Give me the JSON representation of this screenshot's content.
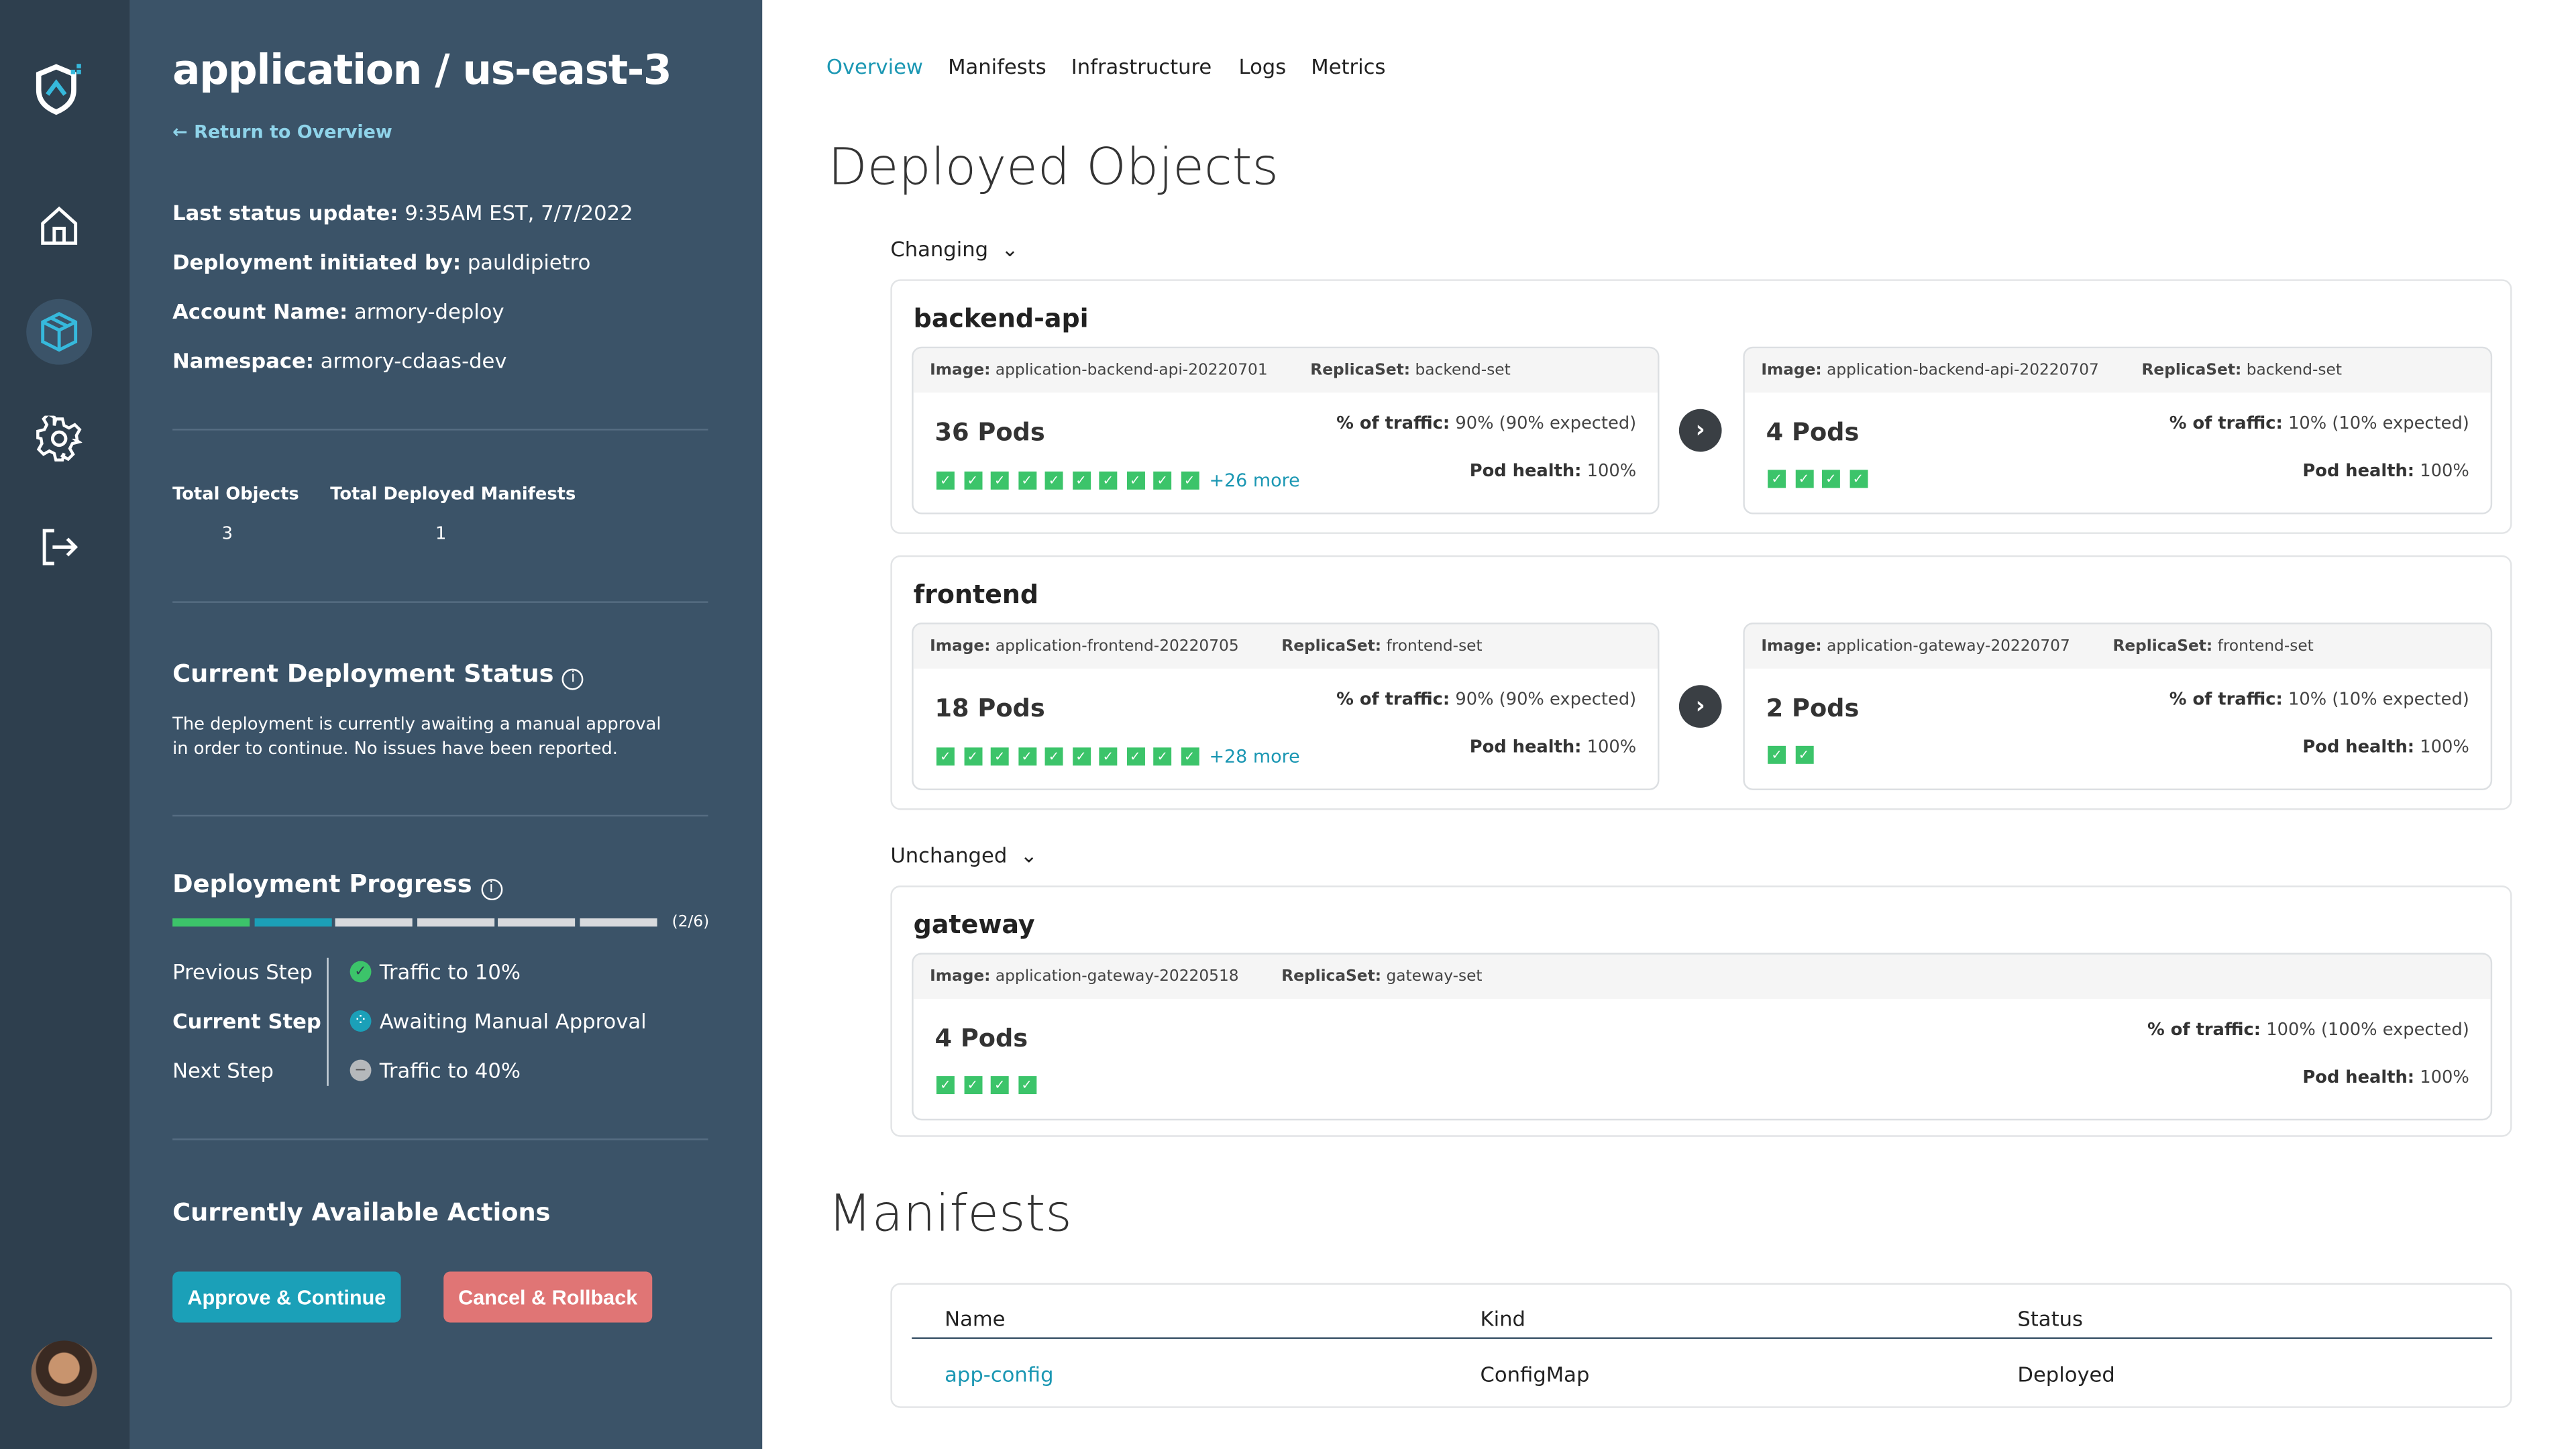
{
  "rail": {
    "items": [
      {
        "icon": "logo-shield-icon"
      },
      {
        "icon": "home-icon"
      },
      {
        "icon": "deployments-cube-icon",
        "active": true
      },
      {
        "icon": "gear-icon"
      },
      {
        "icon": "logout-icon"
      },
      {
        "icon": "avatar"
      }
    ]
  },
  "panel": {
    "title": "application / us-east-3",
    "back_link": "Return to Overview",
    "info": [
      {
        "label": "Last status update:",
        "value": "9:35AM EST, 7/7/2022"
      },
      {
        "label": "Deployment initiated by:",
        "value": "pauldipietro"
      },
      {
        "label": "Account Name:",
        "value": "armory-deploy"
      },
      {
        "label": "Namespace:",
        "value": "armory-cdaas-dev"
      }
    ],
    "totals": [
      {
        "label": "Total Objects",
        "value": "3"
      },
      {
        "label": "Total Deployed Manifests",
        "value": "1"
      }
    ],
    "status": {
      "heading": "Current Deployment Status",
      "text": "The deployment is currently awaiting a manual approval in order to continue. No issues have been reported."
    },
    "progress": {
      "heading": "Deployment Progress",
      "completed": 2,
      "total": 6,
      "counter": "(2/6)",
      "steps": [
        {
          "label": "Previous Step",
          "value": "Traffic to 10%",
          "state": "done"
        },
        {
          "label": "Current Step",
          "value": "Awaiting Manual Approval",
          "state": "in-progress"
        },
        {
          "label": "Next Step",
          "value": "Traffic to 40%",
          "state": "pending"
        }
      ]
    },
    "actions": {
      "heading": "Currently Available Actions",
      "approve": "Approve & Continue",
      "cancel": "Cancel & Rollback"
    }
  },
  "tabs": [
    "Overview",
    "Manifests",
    "Infrastructure",
    "Logs",
    "Metrics"
  ],
  "active_tab": "Overview",
  "deployed": {
    "heading": "Deployed Objects",
    "changing_label": "Changing",
    "unchanged_label": "Unchanged",
    "labels": {
      "image": "Image:",
      "replicaset": "ReplicaSet:",
      "traffic": "% of traffic:",
      "health": "Pod health:"
    },
    "objects": [
      {
        "name": "backend-api",
        "from": {
          "image": "application-backend-api-20220701",
          "replicaset": "backend-set",
          "pods": "36 Pods",
          "traffic": "90% (90% expected)",
          "health": "100%",
          "shown": 10,
          "more": "+26 more"
        },
        "to": {
          "image": "application-backend-api-20220707",
          "replicaset": "backend-set",
          "pods": "4 Pods",
          "traffic": "10% (10% expected)",
          "health": "100%",
          "shown": 4
        }
      },
      {
        "name": "frontend",
        "from": {
          "image": "application-frontend-20220705",
          "replicaset": "frontend-set",
          "pods": "18 Pods",
          "traffic": "90% (90% expected)",
          "health": "100%",
          "shown": 10,
          "more": "+28 more"
        },
        "to": {
          "image": "application-gateway-20220707",
          "replicaset": "frontend-set",
          "pods": "2 Pods",
          "traffic": "10% (10% expected)",
          "health": "100%",
          "shown": 2
        }
      },
      {
        "name": "gateway",
        "from": {
          "image": "application-gateway-20220518",
          "replicaset": "gateway-set",
          "pods": "4 Pods",
          "traffic": "100% (100% expected)",
          "health": "100%",
          "shown": 4
        }
      }
    ]
  },
  "manifests": {
    "heading": "Manifests",
    "columns": [
      "Name",
      "Kind",
      "Status"
    ],
    "rows": [
      {
        "name": "app-config",
        "kind": "ConfigMap",
        "status": "Deployed"
      }
    ]
  },
  "colors": {
    "accent": "#1b97b3",
    "success": "#3cc46a",
    "danger": "#e07575",
    "panel": "#3b5368",
    "rail": "#2e3f4e"
  }
}
